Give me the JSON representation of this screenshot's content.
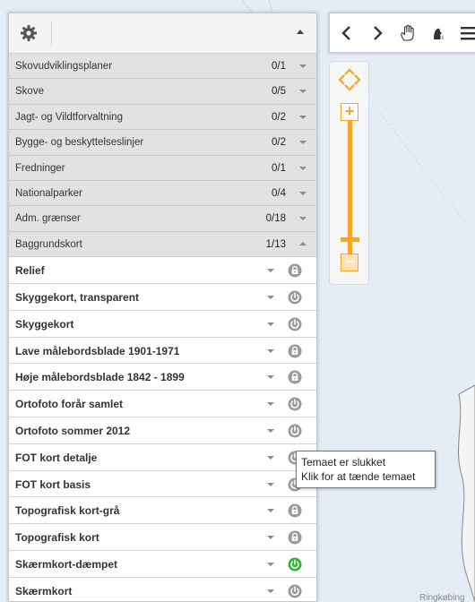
{
  "header": {
    "settings_icon": "gear-icon",
    "collapse_icon": "caret-up-icon"
  },
  "groups": [
    {
      "label": "Skovudviklingsplaner",
      "count": "0/1",
      "expanded": false
    },
    {
      "label": "Skove",
      "count": "0/5",
      "expanded": false
    },
    {
      "label": "Jagt- og Vildtforvaltning",
      "count": "0/2",
      "expanded": false
    },
    {
      "label": "Bygge- og beskyttelseslinjer",
      "count": "0/2",
      "expanded": false
    },
    {
      "label": "Fredninger",
      "count": "0/1",
      "expanded": false
    },
    {
      "label": "Nationalparker",
      "count": "0/4",
      "expanded": false
    },
    {
      "label": "Adm. grænser",
      "count": "0/18",
      "expanded": false
    },
    {
      "label": "Baggrundskort",
      "count": "1/13",
      "expanded": true
    }
  ],
  "layers": [
    {
      "label": "Relief",
      "icon": "lock-icon",
      "state": "locked"
    },
    {
      "label": "Skyggekort, transparent",
      "icon": "power-icon",
      "state": "off"
    },
    {
      "label": "Skyggekort",
      "icon": "power-icon",
      "state": "off"
    },
    {
      "label": "Lave målebordsblade 1901-1971",
      "icon": "lock-icon",
      "state": "locked"
    },
    {
      "label": "Høje målebordsblade 1842 - 1899",
      "icon": "lock-icon",
      "state": "locked"
    },
    {
      "label": "Ortofoto forår samlet",
      "icon": "power-icon",
      "state": "off"
    },
    {
      "label": "Ortofoto sommer 2012",
      "icon": "power-icon",
      "state": "off"
    },
    {
      "label": "FOT kort detalje",
      "icon": "power-icon",
      "state": "off"
    },
    {
      "label": "FOT kort basis",
      "icon": "power-icon",
      "state": "off"
    },
    {
      "label": "Topografisk kort-grå",
      "icon": "lock-icon",
      "state": "locked"
    },
    {
      "label": "Topografisk kort",
      "icon": "lock-icon",
      "state": "locked"
    },
    {
      "label": "Skærmkort-dæmpet",
      "icon": "power-icon",
      "state": "on"
    },
    {
      "label": "Skærmkort",
      "icon": "power-icon",
      "state": "off"
    }
  ],
  "toolbar": {
    "back_icon": "chevron-left-icon",
    "forward_icon": "chevron-right-icon",
    "pan_icon": "hand-icon",
    "info_icon": "info-pointer-icon",
    "menu_icon": "menu-icon"
  },
  "zoom": {
    "pan_icon": "pan-arrows-icon",
    "zoom_in_label": "+",
    "zoom_out_label": "−"
  },
  "tooltip": {
    "line1": "Temaet er slukket",
    "line2": "Klik for at tænde temaet"
  },
  "map": {
    "place_label": "Ringkøbing"
  },
  "colors": {
    "accent": "#f5a623",
    "on": "#2fb52f",
    "off": "#9a9a9a"
  }
}
